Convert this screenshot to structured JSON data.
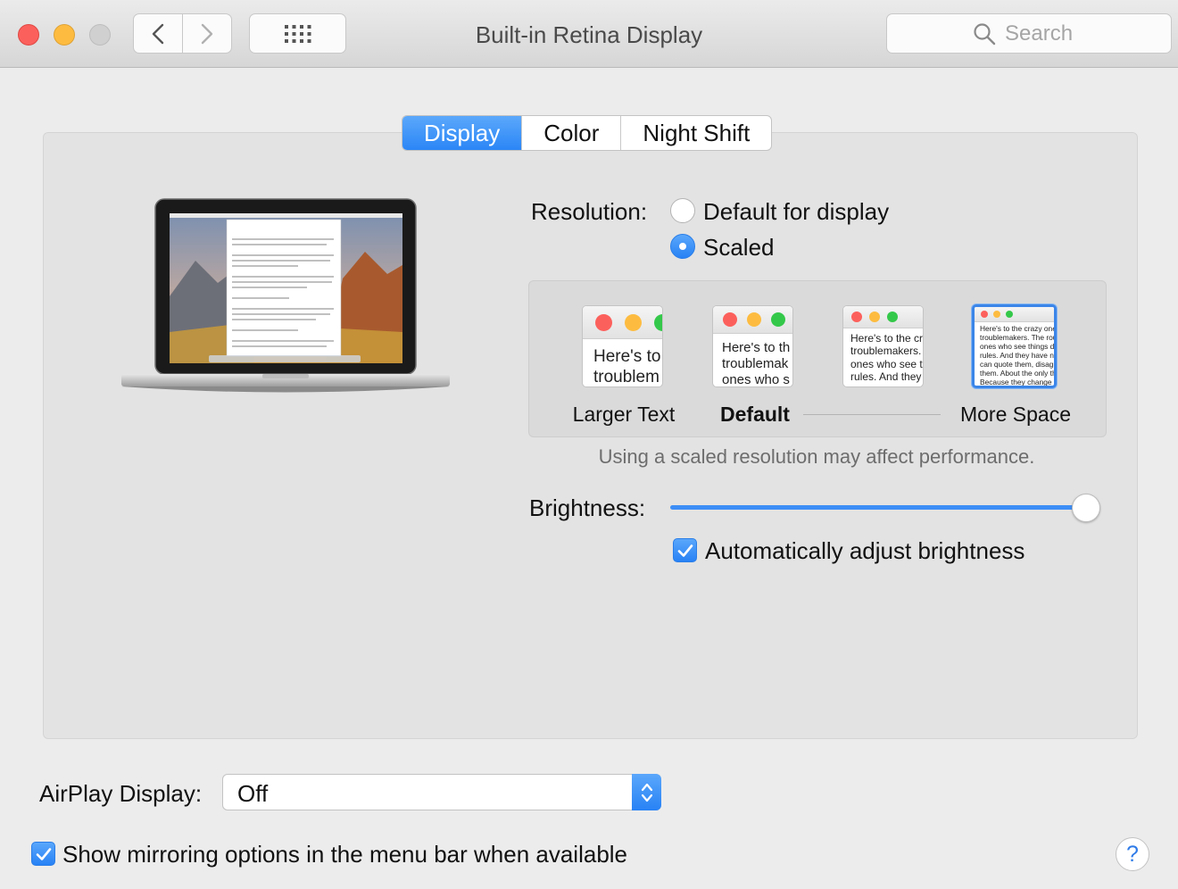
{
  "window": {
    "title": "Built-in Retina Display",
    "search_placeholder": "Search"
  },
  "tabs": [
    {
      "label": "Display",
      "active": true
    },
    {
      "label": "Color",
      "active": false
    },
    {
      "label": "Night Shift",
      "active": false
    }
  ],
  "resolution": {
    "label": "Resolution:",
    "options": [
      {
        "label": "Default for display",
        "selected": false
      },
      {
        "label": "Scaled",
        "selected": true
      }
    ],
    "scaled_options": [
      {
        "label": "Larger Text",
        "preview_text": "Here's to\ntroublem",
        "selected": false
      },
      {
        "label": "Default",
        "preview_text": "Here's to th\ntroublemak\nones who s",
        "selected": false
      },
      {
        "label": "",
        "preview_text": "Here's to the cr\ntroublemakers.\nones who see t\nrules. And they",
        "selected": false
      },
      {
        "label": "More Space",
        "preview_text": "Here's to the crazy one\ntroublemakers. The rou\nones who see things di\nrules. And they have no\ncan quote them, disagr\nthem. About the only th\nBecause they change t",
        "selected": true
      }
    ],
    "note": "Using a scaled resolution may affect performance."
  },
  "brightness": {
    "label": "Brightness:",
    "level": 0.97,
    "auto_label": "Automatically adjust brightness",
    "auto_checked": true
  },
  "airplay": {
    "label": "AirPlay Display:",
    "value": "Off"
  },
  "mirroring": {
    "label": "Show mirroring options in the menu bar when available",
    "checked": true
  },
  "colors": {
    "accent": "#2b86f6",
    "close": "#fc605c",
    "minimize": "#fdbc40"
  }
}
